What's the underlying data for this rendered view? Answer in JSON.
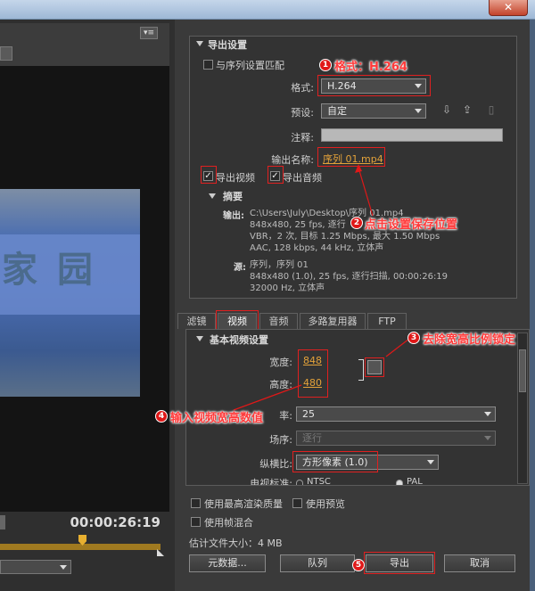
{
  "export": {
    "section_title": "导出设置",
    "match_sequence_label": "与序列设置匹配",
    "format_label": "格式:",
    "format_value": "H.264",
    "preset_label": "预设:",
    "preset_value": "自定",
    "comment_label": "注释:",
    "comment_value": "",
    "output_name_label": "输出名称:",
    "output_name_value": "序列 01.mp4",
    "export_video_label": "导出视频",
    "export_audio_label": "导出音频"
  },
  "summary": {
    "title": "摘要",
    "output_label": "输出:",
    "output_lines": [
      "C:\\Users\\July\\Desktop\\序列 01.mp4",
      "848x480, 25 fps, 逐行",
      "VBR，2 次, 目标 1.25 Mbps, 最大 1.50 Mbps",
      "AAC, 128 kbps, 44 kHz, 立体声"
    ],
    "source_label": "源:",
    "source_lines": [
      "序列，序列 01",
      "848x480 (1.0), 25 fps, 逐行扫描, 00:00:26:19",
      "32000 Hz, 立体声"
    ]
  },
  "tabs": [
    "滤镜",
    "视频",
    "音频",
    "多路复用器",
    "FTP"
  ],
  "video": {
    "section_title": "基本视频设置",
    "width_label": "宽度:",
    "width_value": "848",
    "height_label": "高度:",
    "height_value": "480",
    "framerate_label_partial": "率:",
    "framerate_value": "25",
    "field_order_label": "场序:",
    "field_order_value": "逐行",
    "aspect_label": "纵横比:",
    "aspect_value": "方形像素 (1.0)",
    "tv_standard_label": "电视标准:",
    "ntsc_label": "NTSC",
    "pal_label": "PAL"
  },
  "bottom": {
    "max_render_label": "使用最高渲染质量",
    "use_preview_label": "使用预览",
    "frame_blend_label": "使用帧混合",
    "file_size_label": "估计文件大小：4 MB",
    "metadata_button": "元数据...",
    "queue_button": "队列",
    "export_button": "导出",
    "cancel_button": "取消"
  },
  "preview": {
    "timecode": "00:00:26:19",
    "watermark_a": "家",
    "watermark_b": "园"
  },
  "annotations": {
    "a1": "格式：H.264",
    "a2": "点击设置保存位置",
    "a3": "去除宽高比例锁定",
    "a4": "输入视频宽高数值",
    "a5": "",
    "n1": "1",
    "n2": "2",
    "n3": "3",
    "n4": "4",
    "n5": "5"
  },
  "window": {
    "close_glyph": "✕"
  },
  "colors": {
    "annotation_red": "#e01818",
    "value_gold": "#e3a23a",
    "panel_bg": "#333333"
  }
}
